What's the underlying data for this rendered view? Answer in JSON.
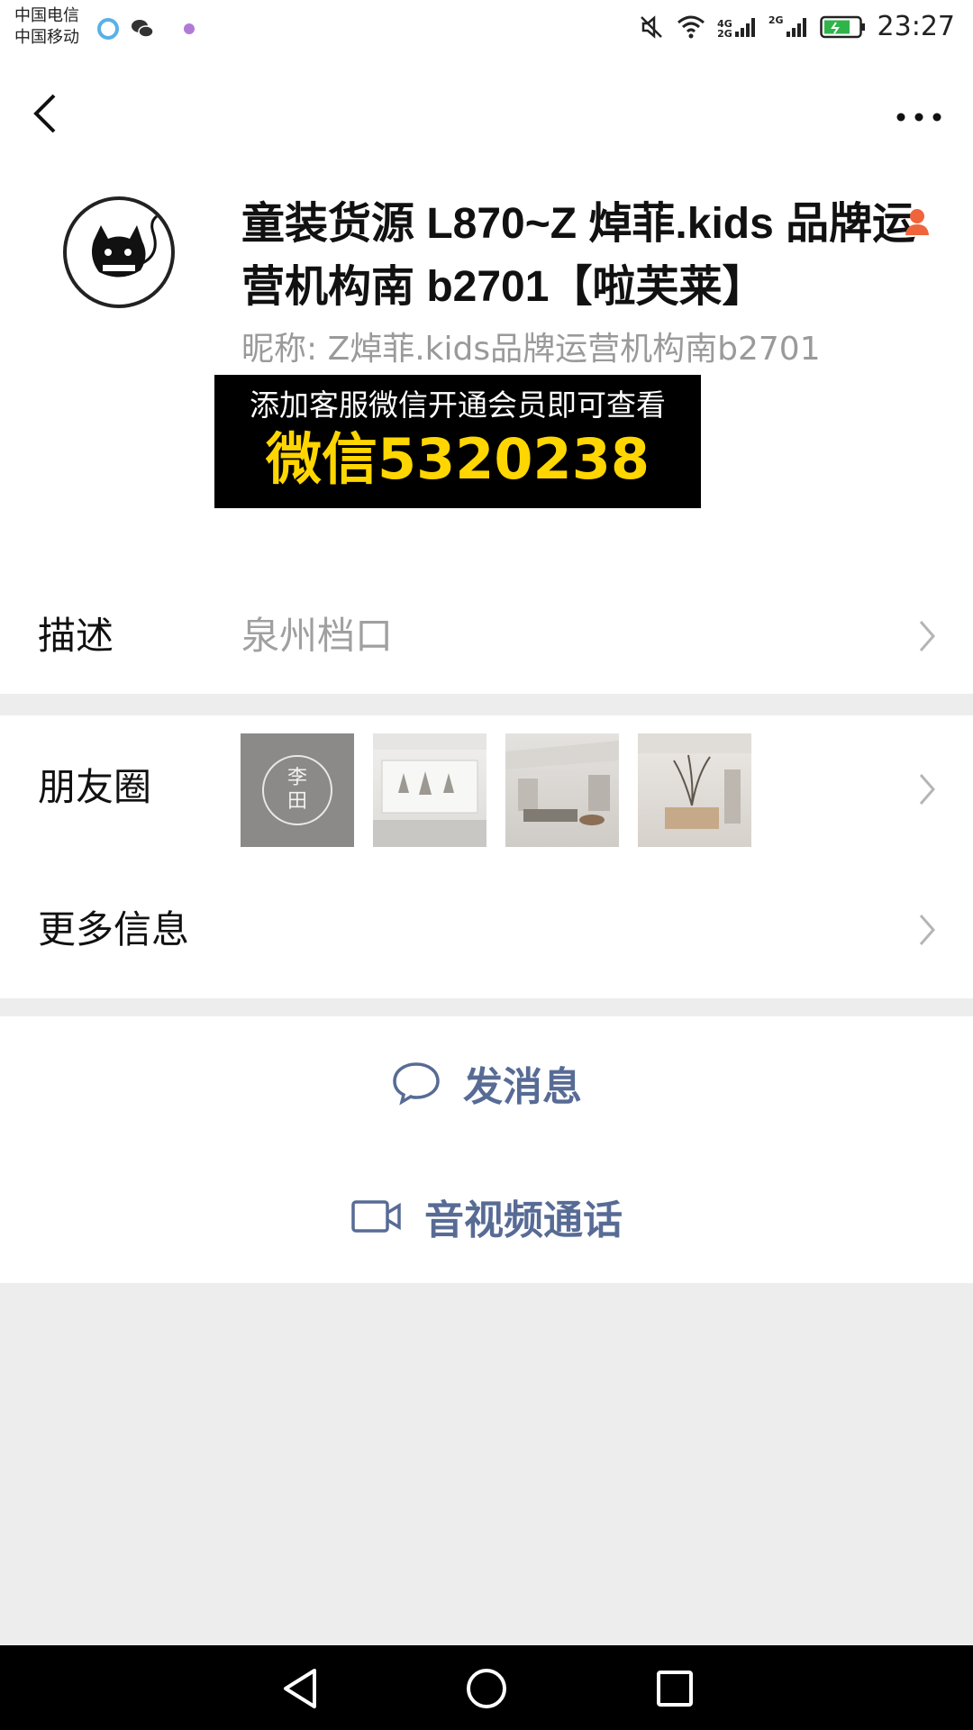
{
  "status_bar": {
    "carrier_1": "中国电信",
    "carrier_2": "中国移动",
    "net_1": "4G",
    "net_2": "2G",
    "net_3": "2G",
    "time": "23:27",
    "app_icons": [
      "qq-browser-icon",
      "wechat-icon",
      "notification-dot-icon"
    ],
    "system_icons": [
      "mute-icon",
      "wifi-icon",
      "signal-icon",
      "signal-icon",
      "battery-charging-icon"
    ]
  },
  "nav": {
    "back_icon": "chevron-left-icon",
    "more_icon": "more-dots-icon"
  },
  "profile": {
    "name": "童装货源 L870~Z 焯菲.kids 品牌运营机构南 b2701【啦芙莱】",
    "gender_icon": "female-person-icon",
    "gender_color": "#f0643c",
    "nickname": "昵称:  Z焯菲.kids品牌运营机构南b2701",
    "promo_line1": "添加客服微信开通会员即可查看",
    "promo_line2": "微信5320238",
    "promo_text_color": "#ffd600"
  },
  "rows": {
    "description_label": "描述",
    "description_value": "泉州档口",
    "moments_label": "朋友圈",
    "moments_thumb_text": "李\n田",
    "more_info_label": "更多信息"
  },
  "actions": {
    "message_label": "发消息",
    "call_label": "音视频通话",
    "accent_color": "#576b95"
  }
}
